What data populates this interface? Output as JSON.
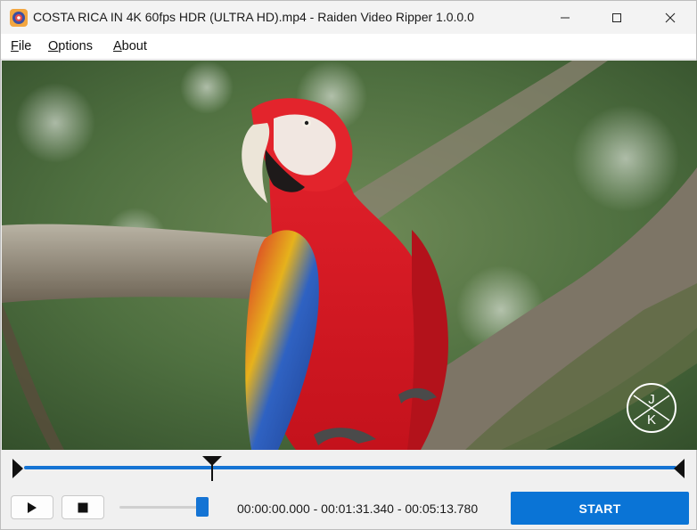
{
  "window": {
    "title": "COSTA RICA IN 4K 60fps HDR (ULTRA HD).mp4 - Raiden Video Ripper 1.0.0.0",
    "app_icon": "raiden-app-icon",
    "buttons": [
      "minimize-icon",
      "maximize-icon",
      "close-icon"
    ]
  },
  "menu": {
    "file": {
      "underline": "F",
      "rest": "ile"
    },
    "options": {
      "underline": "O",
      "rest": "ptions"
    },
    "about": {
      "underline": "A",
      "rest": "bout"
    }
  },
  "video": {
    "watermark_top": "J",
    "watermark_bottom": "K"
  },
  "timeline": {
    "playhead_position": 0.2892
  },
  "controls": {
    "play_icon": "play-icon",
    "stop_icon": "stop-icon",
    "volume_level": 0.86,
    "time_text": "00:00:00.000 - 00:01:31.340 - 00:05:13.780",
    "start_label": "START"
  },
  "colors": {
    "accent": "#0a74d6",
    "track": "#1574d4",
    "background": "#f0f0f0"
  }
}
